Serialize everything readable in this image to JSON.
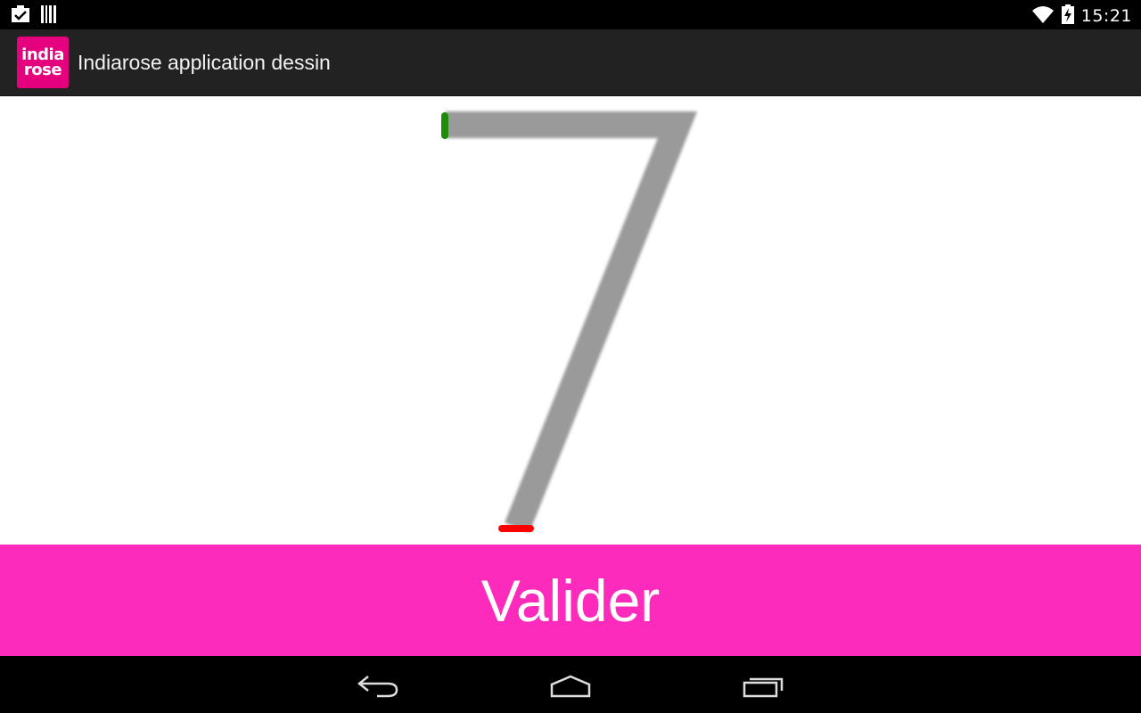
{
  "status_bar": {
    "time": "15:21",
    "icons": [
      "clipboard-check-icon",
      "barcode-icon",
      "wifi-icon",
      "battery-charging-icon"
    ]
  },
  "action_bar": {
    "logo_line1": "india",
    "logo_line2": "rose",
    "title": "Indiarose application dessin"
  },
  "drawing": {
    "digit": "7",
    "stroke_color": "#9a9a9a",
    "start_marker_color": "#1e8c0a",
    "end_marker_color": "#ff0000"
  },
  "validate": {
    "label": "Valider",
    "color": "#fc2bbb"
  },
  "nav_bar": {
    "buttons": [
      "back-icon",
      "home-icon",
      "recent-apps-icon"
    ]
  }
}
